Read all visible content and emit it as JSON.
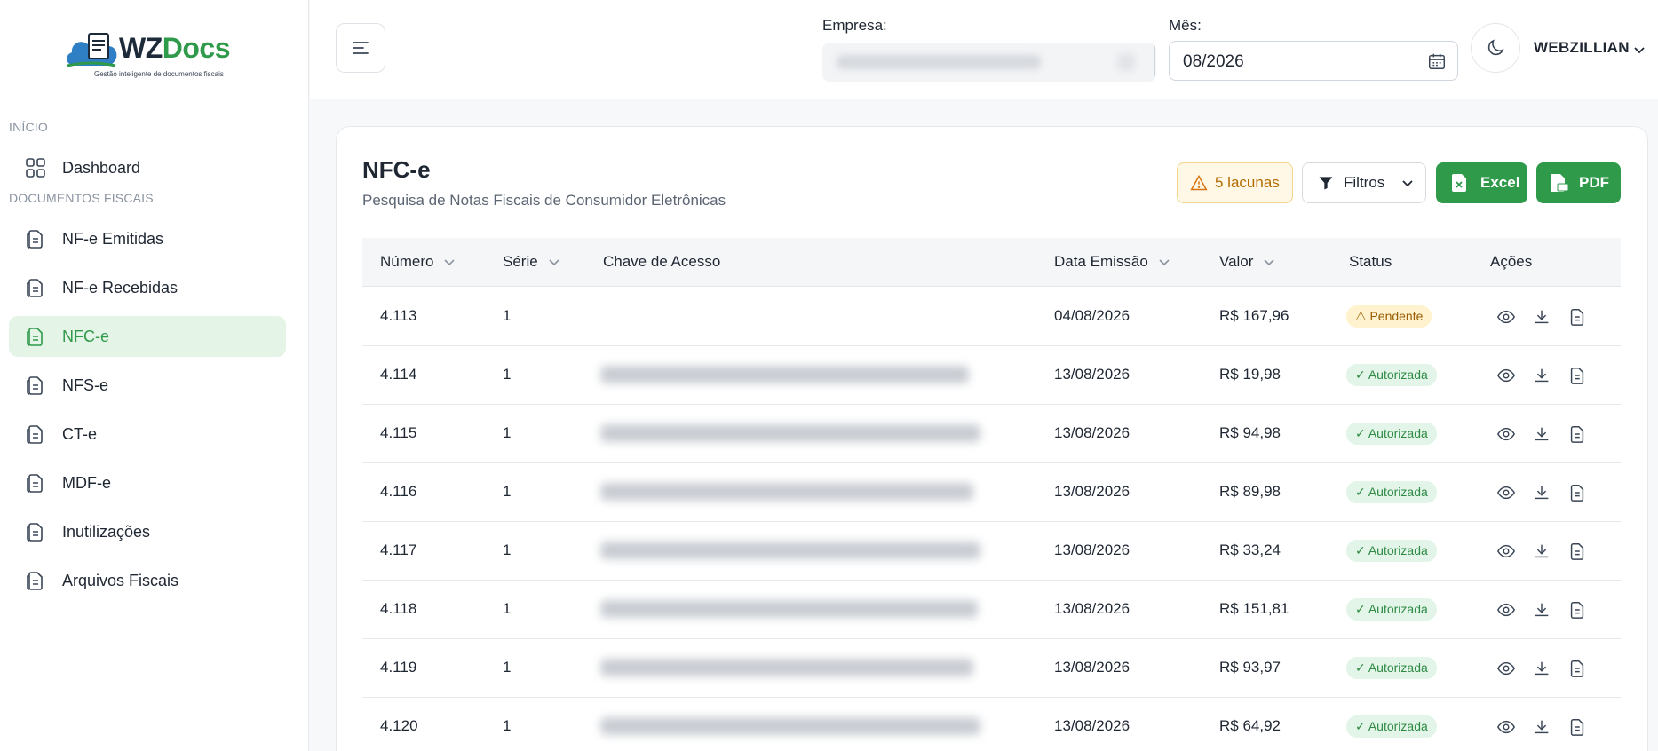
{
  "app": {
    "brand_wz": "WZ",
    "brand_docs": "Docs",
    "tagline": "Gestão inteligente de documentos fiscais",
    "accent": "#2e9a4a"
  },
  "sidebar": {
    "section_inicio": "INÍCIO",
    "section_docs": "DOCUMENTOS FISCAIS",
    "items": [
      {
        "label": "Dashboard",
        "icon": "grid-icon"
      },
      {
        "label": "NF-e Emitidas",
        "icon": "document-icon"
      },
      {
        "label": "NF-e Recebidas",
        "icon": "document-icon"
      },
      {
        "label": "NFC-e",
        "icon": "document-icon",
        "active": true
      },
      {
        "label": "NFS-e",
        "icon": "document-icon"
      },
      {
        "label": "CT-e",
        "icon": "document-icon"
      },
      {
        "label": "MDF-e",
        "icon": "document-icon"
      },
      {
        "label": "Inutilizações",
        "icon": "document-icon"
      },
      {
        "label": "Arquivos Fiscais",
        "icon": "document-icon"
      }
    ]
  },
  "header": {
    "empresa_label": "Empresa:",
    "mes_label": "Mês:",
    "mes_value": "08/2026",
    "user_name": "WEBZILLIAN"
  },
  "page": {
    "title": "NFC-e",
    "subtitle": "Pesquisa de Notas Fiscais de Consumidor Eletrônicas"
  },
  "toolbar": {
    "gaps_label": "5 lacunas",
    "filters_label": "Filtros",
    "excel_label": "Excel",
    "pdf_label": "PDF"
  },
  "table": {
    "columns": {
      "numero": "Número",
      "serie": "Série",
      "chave": "Chave de Acesso",
      "data": "Data Emissão",
      "valor": "Valor",
      "status": "Status",
      "acoes": "Ações"
    },
    "rows": [
      {
        "numero": "4.113",
        "serie": "1",
        "data": "04/08/2026",
        "valor": "R$ 167,96",
        "status": "⚠ Pendente",
        "status_type": "pending"
      },
      {
        "numero": "4.114",
        "serie": "1",
        "data": "13/08/2026",
        "valor": "R$ 19,98",
        "status": "✓ Autorizada",
        "status_type": "ok"
      },
      {
        "numero": "4.115",
        "serie": "1",
        "data": "13/08/2026",
        "valor": "R$ 94,98",
        "status": "✓ Autorizada",
        "status_type": "ok"
      },
      {
        "numero": "4.116",
        "serie": "1",
        "data": "13/08/2026",
        "valor": "R$ 89,98",
        "status": "✓ Autorizada",
        "status_type": "ok"
      },
      {
        "numero": "4.117",
        "serie": "1",
        "data": "13/08/2026",
        "valor": "R$ 33,24",
        "status": "✓ Autorizada",
        "status_type": "ok"
      },
      {
        "numero": "4.118",
        "serie": "1",
        "data": "13/08/2026",
        "valor": "R$ 151,81",
        "status": "✓ Autorizada",
        "status_type": "ok"
      },
      {
        "numero": "4.119",
        "serie": "1",
        "data": "13/08/2026",
        "valor": "R$ 93,97",
        "status": "✓ Autorizada",
        "status_type": "ok"
      },
      {
        "numero": "4.120",
        "serie": "1",
        "data": "13/08/2026",
        "valor": "R$ 64,92",
        "status": "✓ Autorizada",
        "status_type": "ok"
      }
    ]
  }
}
